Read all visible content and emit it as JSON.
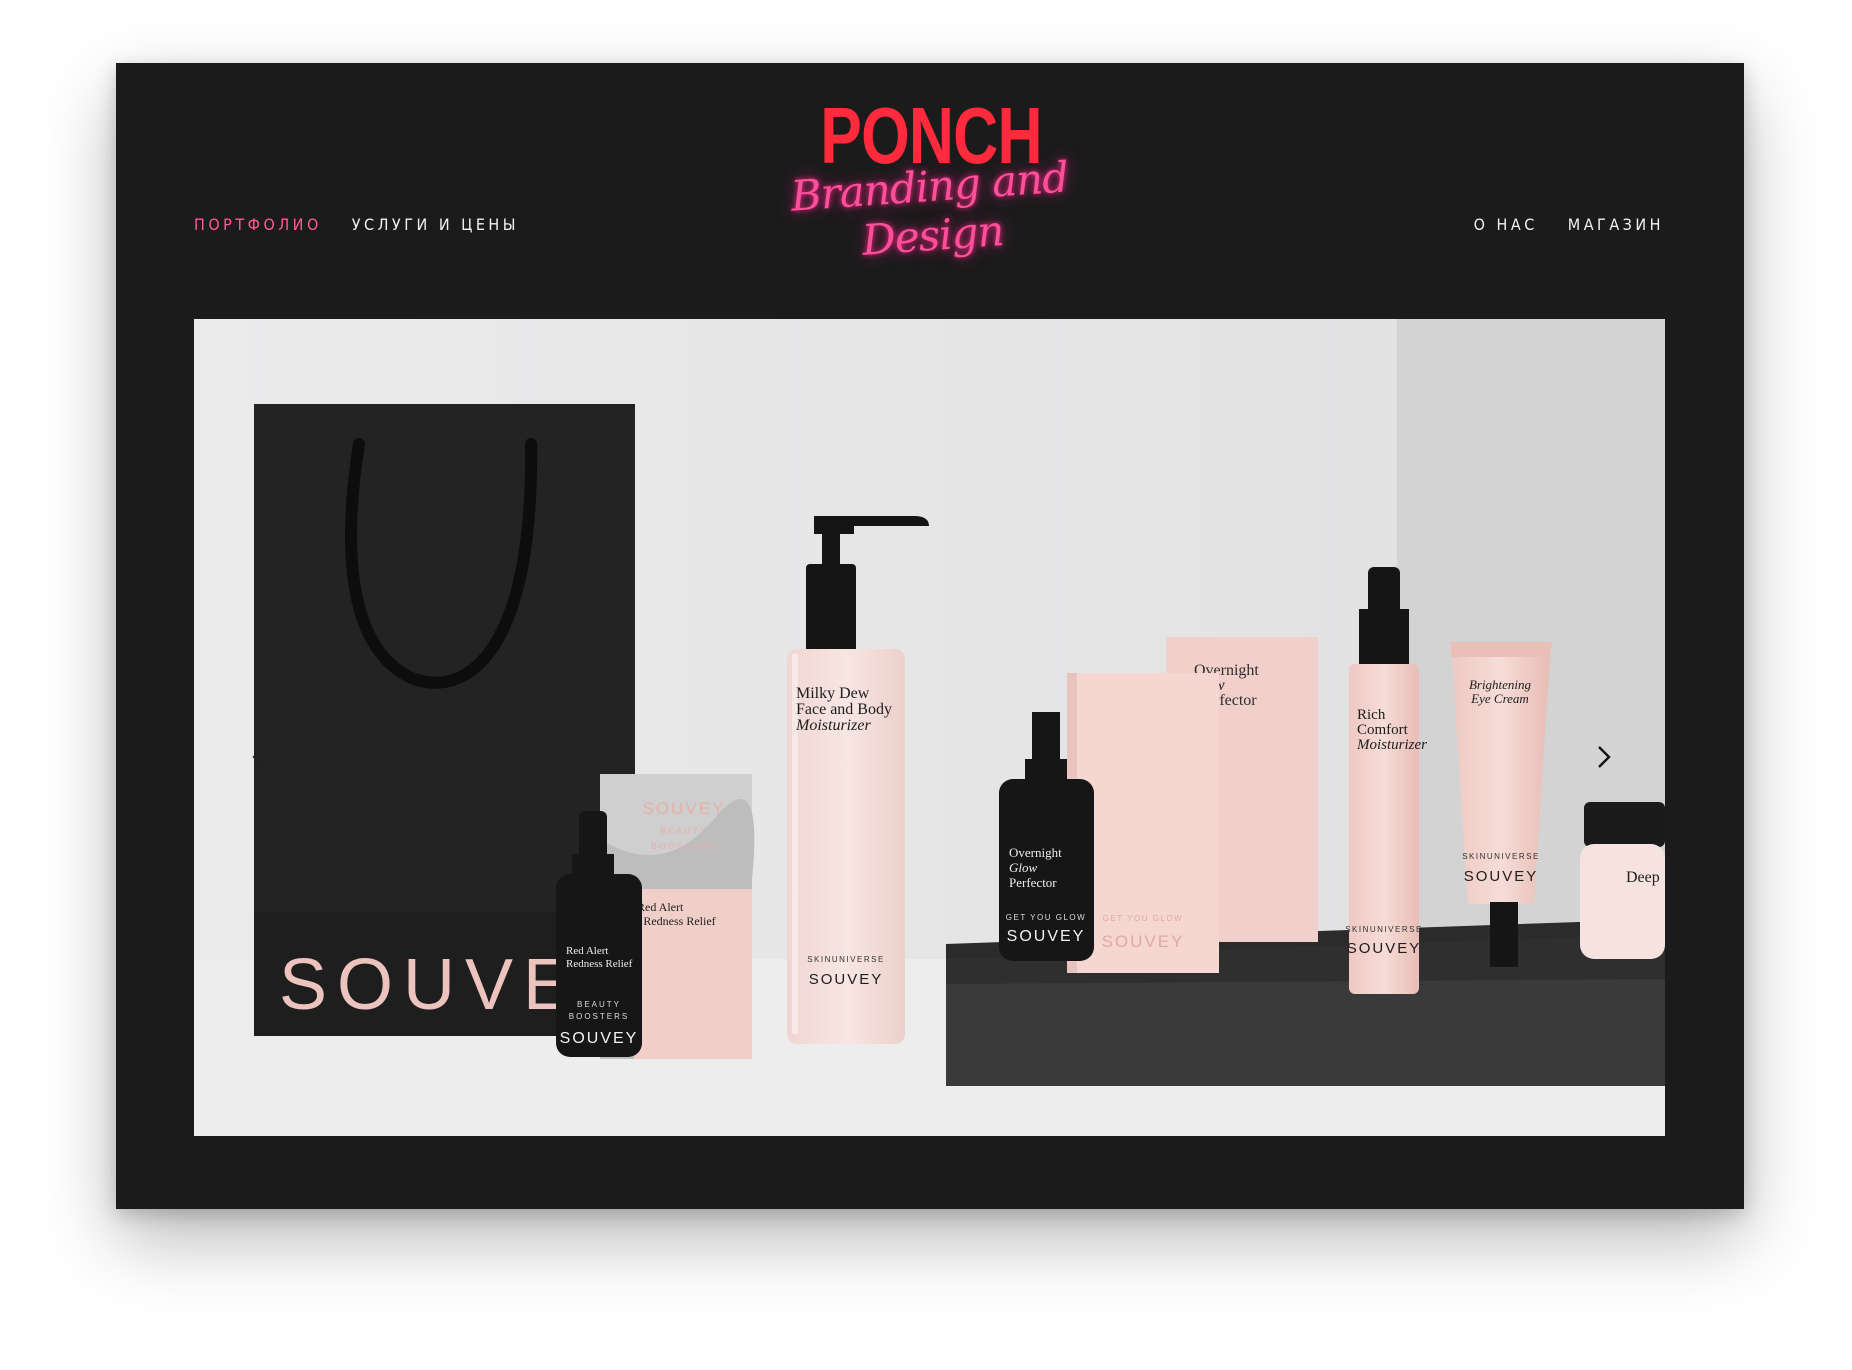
{
  "logo": {
    "title": "PONCH",
    "tagline": "Branding and Design"
  },
  "nav": {
    "left": [
      "ПОРТФОЛИО",
      "УСЛУГИ И ЦЕНЫ"
    ],
    "right": [
      "О НАС",
      "МАГАЗИН"
    ],
    "active": "ПОРТФОЛИО"
  },
  "colors": {
    "background": "#1b1b1c",
    "accent_pink": "#ff5a9b",
    "logo_red": "#ff2a3c",
    "nav_text": "#f2f2f2"
  },
  "slider": {
    "prev_icon": "chevron-left-icon",
    "next_icon": "chevron-right-icon",
    "bag": {
      "brand": "SOUVEY"
    },
    "booster_card": {
      "brand": "SOUVEY",
      "line1": "BEAUTY",
      "line2": "BOOSTERS",
      "name1": "Red Alert",
      "name2": "/ Redness Relief"
    },
    "dropper_red_alert": {
      "name1": "Red Alert",
      "name2": "Redness Relief",
      "sub1": "BEAUTY",
      "sub2": "BOOSTERS",
      "brand": "SOUVEY"
    },
    "pump_bottle": {
      "name1": "Milky Dew",
      "name2": "Face and Body",
      "name3": "Moisturizer",
      "sub": "SKINUNIVERSE",
      "brand": "SOUVEY"
    },
    "box_overnight": {
      "name1": "Overnight",
      "name2": "w",
      "name3": "rfector"
    },
    "box_glow": {
      "sub": "GET YOU GLOW",
      "brand": "SOUVEY"
    },
    "dropper_overnight": {
      "name1": "Overnight",
      "name2": "Glow",
      "name3": "Perfector",
      "sub": "GET YOU GLOW",
      "brand": "SOUVEY"
    },
    "rich_bottle": {
      "name1": "Rich",
      "name2": "Comfort",
      "name3": "Moisturizer",
      "sub": "SKINUNIVERSE",
      "brand": "SOUVEY"
    },
    "eye_tube": {
      "name1": "Brightening",
      "name2": "Eye Cream",
      "sub": "SKINUNIVERSE",
      "brand": "SOUVEY"
    },
    "jar": {
      "name": "Deep"
    }
  }
}
